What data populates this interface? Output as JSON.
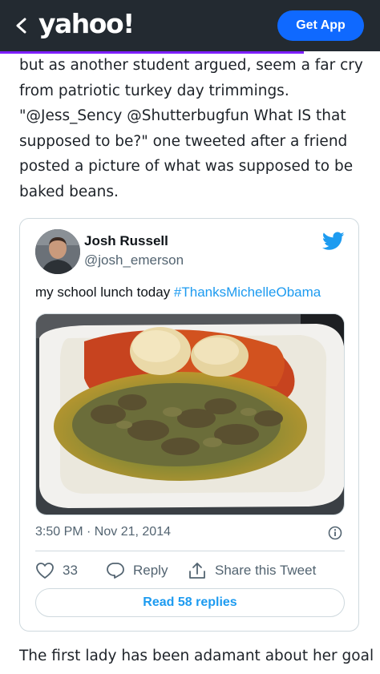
{
  "header": {
    "logo_text": "yahoo!",
    "get_app_label": "Get App",
    "background_color": "#232a31",
    "accent_color": "#0f69ff"
  },
  "reading_progress": {
    "fraction": 0.8,
    "color": "#7e1fff"
  },
  "article": {
    "lines": [
      "but as another student argued, seem a far cry",
      "from patriotic turkey day trimmings.",
      "\"@Jess_Sency @Shutterbugfun What IS that",
      "supposed to be?\" one tweeted after a friend",
      "posted a picture of what was supposed to be",
      "baked beans."
    ],
    "after_embed": "The first lady has been adamant about her goal"
  },
  "tweet": {
    "author_name": "Josh Russell",
    "author_handle": "@josh_emerson",
    "text": "my school lunch today ",
    "hashtag": "#ThanksMichelleObama",
    "timestamp": "3:50 PM · Nov 21, 2014",
    "like_count": "33",
    "reply_label": "Reply",
    "share_label": "Share this Tweet",
    "read_replies_label": "Read 58 replies",
    "brand_color": "#1d9bf0"
  },
  "icons": {
    "back": "chevron-left-icon",
    "twitter": "twitter-bird-icon",
    "info": "info-icon",
    "like": "heart-icon",
    "reply": "reply-icon",
    "share": "share-icon"
  }
}
